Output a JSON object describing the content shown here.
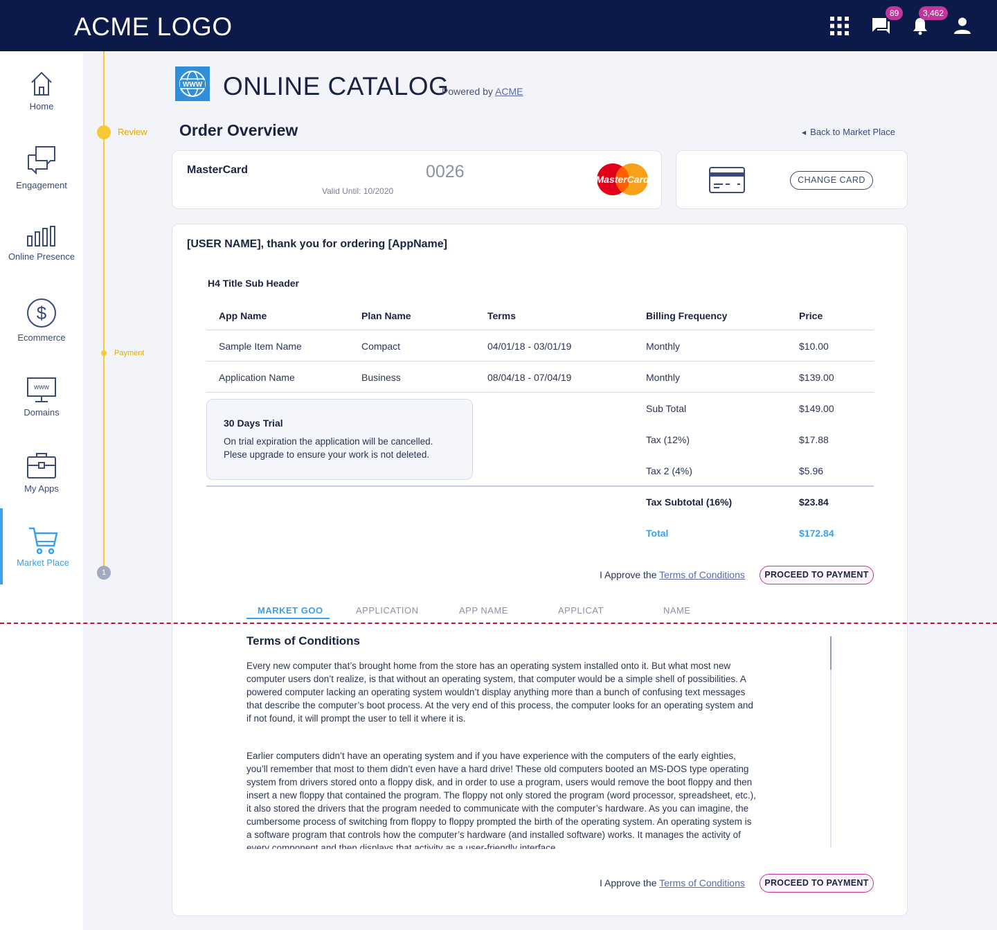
{
  "header": {
    "logo": "ACME LOGO",
    "chat_badge": "89",
    "notif_badge": "3,462"
  },
  "sidebar": {
    "items": [
      {
        "label": "Home",
        "icon": "home-icon"
      },
      {
        "label": "Engagement",
        "icon": "chat-icon"
      },
      {
        "label": "Online Presence",
        "icon": "bar-chart-icon"
      },
      {
        "label": "Ecommerce",
        "icon": "dollar-icon"
      },
      {
        "label": "Domains",
        "icon": "www-monitor-icon"
      },
      {
        "label": "My Apps",
        "icon": "briefcase-icon"
      },
      {
        "label": "Market Place",
        "icon": "cart-icon",
        "active": true
      }
    ]
  },
  "stepper": {
    "step1": "Review",
    "step2": "Payment",
    "step_number": "1"
  },
  "page": {
    "catalog_title": "ONLINE CATALOG",
    "powered_prefix": "Powered by",
    "powered_link": "ACME",
    "order_title": "Order Overview",
    "back_link": "Back to Market Place"
  },
  "card": {
    "name": "MasterCard",
    "number": "0026",
    "valid": "Valid Until: 10/2020",
    "logo_text": "MasterCard",
    "change_button": "CHANGE CARD"
  },
  "order": {
    "thanks": "[USER NAME], thank you for ordering [AppName]",
    "subheader": "H4 Title Sub Header",
    "columns": [
      "App Name",
      "Plan Name",
      "Terms",
      "Billing Frequency",
      "Price"
    ],
    "rows": [
      [
        "Sample Item Name",
        "Compact",
        "04/01/18 - 03/01/19",
        "Monthly",
        "$10.00"
      ],
      [
        "Application Name",
        "Business",
        "08/04/18 - 07/04/19",
        "Monthly",
        "$139.00"
      ]
    ],
    "summary": [
      {
        "label": "Sub Total",
        "value": "$149.00"
      },
      {
        "label": "Tax (12%)",
        "value": "$17.88"
      },
      {
        "label": "Tax 2 (4%)",
        "value": "$5.96"
      }
    ],
    "tax_subtotal_label": "Tax Subtotal (16%)",
    "tax_subtotal_value": "$23.84",
    "total_label": "Total",
    "total_value": "$172.84",
    "trial_title": "30 Days Trial",
    "trial_line1": "On trial expiration the application will be cancelled.",
    "trial_line2": "Plese upgrade to ensure your work is not deleted."
  },
  "approve": {
    "prefix": "I Approve the",
    "link": "Terms of Conditions",
    "button": "PROCEED TO PAYMENT"
  },
  "tabs": [
    "MARKET GOO",
    "APPLICATION",
    "APP NAME",
    "APPLICAT",
    "NAME"
  ],
  "terms": {
    "title": "Terms of Conditions",
    "paragraphs": [
      "Every new computer that’s brought home from the store has an operating system installed onto it. But what most new computer users don’t realize, is that without an operating system, that computer would be a simple shell of possibilities. A powered computer lacking an operating system wouldn’t display anything more than a bunch of confusing text messages that describe the computer’s boot process. At the very end of this process, the computer looks for an operating system and if not found, it will prompt the user to tell it where it is.",
      "Earlier computers didn’t have an operating system and if you have experience with the computers of the early eighties, you’ll remember that most to them didn’t even have a hard drive! These old computers booted an MS-DOS type operating system from drivers stored onto a floppy disk, and in order to use a program, users would remove the boot floppy and then insert a new floppy that contained the program. The floppy not only stored the program (word processor, spreadsheet, etc.), it also stored the drivers that the program needed to communicate with the computer’s hardware. As you can imagine, the cumbersome process of switching from floppy to floppy prompted the birth of the operating system. An operating system is a software program that controls how the computer’s hardware (and installed software) works. It manages the activity of every component and then displays that activity as a user-friendly interface"
    ]
  },
  "colors": {
    "topbar": "#0b1a48",
    "accent": "#3aa0f0",
    "stepper": "#f8c935",
    "badge": "#c2359b"
  }
}
